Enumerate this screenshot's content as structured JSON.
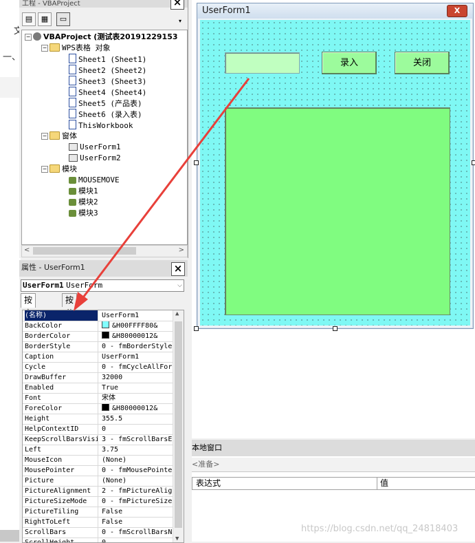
{
  "left_strip": {
    "char_top": "文",
    "char_mid": "一、"
  },
  "project": {
    "title": "工程 - VBAProject",
    "close": "×",
    "tree": [
      {
        "text": "VBAProject (测试表20191229153",
        "kind": "proj",
        "depth": 0
      },
      {
        "text": "WPS表格 对象",
        "kind": "folder",
        "depth": 1
      },
      {
        "text": "Sheet1 (Sheet1)",
        "kind": "sheet",
        "depth": 2
      },
      {
        "text": "Sheet2 (Sheet2)",
        "kind": "sheet",
        "depth": 2
      },
      {
        "text": "Sheet3 (Sheet3)",
        "kind": "sheet",
        "depth": 2
      },
      {
        "text": "Sheet4 (Sheet4)",
        "kind": "sheet",
        "depth": 2
      },
      {
        "text": "Sheet5 (产品表)",
        "kind": "sheet",
        "depth": 2
      },
      {
        "text": "Sheet6 (录入表)",
        "kind": "sheet",
        "depth": 2
      },
      {
        "text": "ThisWorkbook",
        "kind": "sheet",
        "depth": 2
      },
      {
        "text": "窗体",
        "kind": "folder",
        "depth": 1
      },
      {
        "text": "UserForm1",
        "kind": "form",
        "depth": 2
      },
      {
        "text": "UserForm2",
        "kind": "form",
        "depth": 2
      },
      {
        "text": "模块",
        "kind": "folder",
        "depth": 1
      },
      {
        "text": "MOUSEMOVE",
        "kind": "mod",
        "depth": 2
      },
      {
        "text": "模块1",
        "kind": "mod",
        "depth": 2
      },
      {
        "text": "模块2",
        "kind": "mod",
        "depth": 2
      },
      {
        "text": "模块3",
        "kind": "mod",
        "depth": 2
      }
    ]
  },
  "properties": {
    "title": "属性 - UserForm1",
    "close": "×",
    "object_name": "UserForm1",
    "object_type": "UserForm",
    "tabs": [
      "按字母序",
      "按分类序"
    ],
    "rows": [
      {
        "name": "(名称)",
        "value": "UserForm1"
      },
      {
        "name": "BackColor",
        "value": "&H00FFFF80&",
        "swatch": "#80ffff"
      },
      {
        "name": "BorderColor",
        "value": "&H80000012&",
        "swatch": "#000000"
      },
      {
        "name": "BorderStyle",
        "value": "0 - fmBorderStyle"
      },
      {
        "name": "Caption",
        "value": "UserForm1"
      },
      {
        "name": "Cycle",
        "value": "0 - fmCycleAllFor"
      },
      {
        "name": "DrawBuffer",
        "value": "32000"
      },
      {
        "name": "Enabled",
        "value": "True"
      },
      {
        "name": "Font",
        "value": "宋体"
      },
      {
        "name": "ForeColor",
        "value": "&H80000012&",
        "swatch": "#000000"
      },
      {
        "name": "Height",
        "value": "355.5"
      },
      {
        "name": "HelpContextID",
        "value": "0"
      },
      {
        "name": "KeepScrollBarsVisi",
        "value": "3 - fmScrollBarsE"
      },
      {
        "name": "Left",
        "value": "3.75"
      },
      {
        "name": "MouseIcon",
        "value": "(None)"
      },
      {
        "name": "MousePointer",
        "value": "0 - fmMousePointe"
      },
      {
        "name": "Picture",
        "value": "(None)"
      },
      {
        "name": "PictureAlignment",
        "value": "2 - fmPictureAlig"
      },
      {
        "name": "PictureSizeMode",
        "value": "0 - fmPictureSize"
      },
      {
        "name": "PictureTiling",
        "value": "False"
      },
      {
        "name": "RightToLeft",
        "value": "False"
      },
      {
        "name": "ScrollBars",
        "value": "0 - fmScrollBarsN"
      },
      {
        "name": "ScrollHeight",
        "value": "0"
      }
    ]
  },
  "userform": {
    "title": "UserForm1",
    "close": "X",
    "button_enter": "录入",
    "button_close": "关闭"
  },
  "locals": {
    "title": "本地窗口",
    "context": "<准备>",
    "col_expression": "表达式",
    "col_value": "值"
  },
  "watermark": "https://blog.csdn.net/qq_24818403",
  "colors": {
    "form_back": "#80ffff",
    "textbox_back": "#c0ffc0",
    "button_back": "#9cfb9c",
    "frame_back": "#80fc80",
    "arrow": "#e8403a"
  }
}
